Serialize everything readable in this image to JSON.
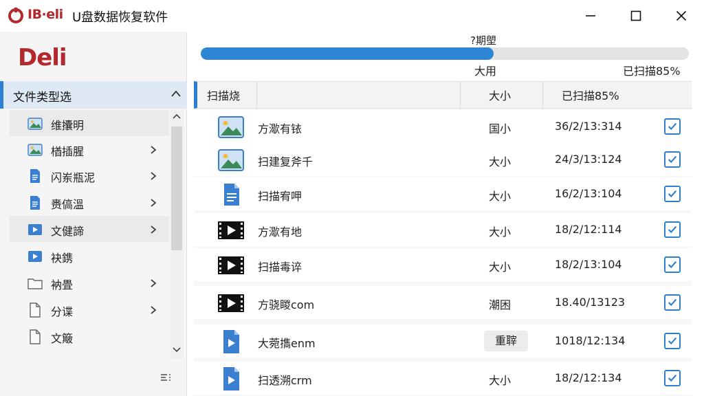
{
  "window": {
    "brand": "IB·eli",
    "title": "U盘数据恢复软件"
  },
  "sidebar": {
    "logo": "Deli",
    "header_label": "文件类型选",
    "items": [
      {
        "label": "维攮明",
        "icon": "image-icon",
        "has_chevron": false
      },
      {
        "label": "楢插腥",
        "icon": "image-icon",
        "has_chevron": true
      },
      {
        "label": "闪岽瓶泥",
        "icon": "document-icon",
        "has_chevron": true
      },
      {
        "label": "赉傐溫",
        "icon": "document-icon",
        "has_chevron": true
      },
      {
        "label": "文健諦",
        "icon": "video-icon",
        "has_chevron": true
      },
      {
        "label": "袂鎸",
        "icon": "video-icon",
        "has_chevron": false
      },
      {
        "label": "衲畳",
        "icon": "folder-icon",
        "has_chevron": true
      },
      {
        "label": "分谍",
        "icon": "file-icon",
        "has_chevron": true
      },
      {
        "label": "文簸",
        "icon": "file-icon",
        "has_chevron": false
      }
    ]
  },
  "progress": {
    "top_label": "?期塱",
    "value_percent": 60,
    "left_label": "大用",
    "right_label": "已扫描85%"
  },
  "table": {
    "headers": [
      "扫描烧",
      "大小",
      "已扫描85%"
    ],
    "rows": [
      {
        "name": "方㵣有铱",
        "size": "国小",
        "date": "36/2/13:314",
        "icon": "image-icon",
        "checked": true
      },
      {
        "name": "扫建复斧千",
        "size": "大小",
        "date": "24/3/13:124",
        "icon": "image-icon",
        "checked": true
      },
      {
        "name": "扫描宥呷",
        "size": "大小",
        "date": "16/2/13:104",
        "icon": "document-icon",
        "checked": true
      },
      {
        "name": "方㵣有地",
        "size": "大小",
        "date": "18/2/12:114",
        "icon": "video-icon",
        "checked": true
      },
      {
        "name": "扫描毒谇",
        "size": "大小",
        "date": "18/2/13:104",
        "icon": "video-icon",
        "checked": true
      },
      {
        "name": "方骁䁓com",
        "size": "潮困",
        "date": "18.40/13123",
        "icon": "video-icon",
        "checked": true
      },
      {
        "name": "大菀㩦enm",
        "size": "重䏁",
        "date": "1018/12:134",
        "icon": "play-doc-icon",
        "checked": true
      },
      {
        "name": "扫透溯crm",
        "size": "大小",
        "date": "18/2/12:134",
        "icon": "play-doc-icon",
        "checked": true
      }
    ]
  },
  "colors": {
    "accent": "#2d85d6",
    "brand_red": "#b3282d",
    "sidebar_bg": "#f5f5f5"
  }
}
